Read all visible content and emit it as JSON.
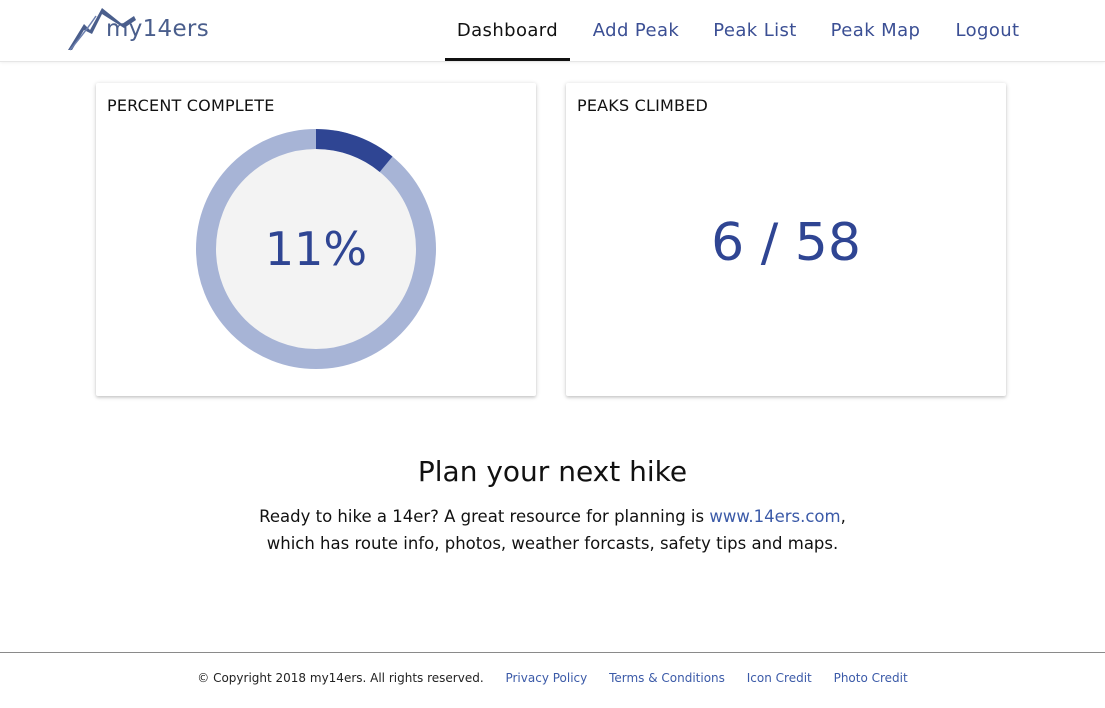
{
  "brand": {
    "logo_text": "my14ers",
    "mountain_icon": "mountain-logo-icon"
  },
  "nav": {
    "items": [
      {
        "label": "Dashboard",
        "active": true
      },
      {
        "label": "Add Peak",
        "active": false
      },
      {
        "label": "Peak List",
        "active": false
      },
      {
        "label": "Peak Map",
        "active": false
      },
      {
        "label": "Logout",
        "active": false
      }
    ]
  },
  "percent_card": {
    "title": "PERCENT COMPLETE",
    "value_label": "11%",
    "progress_fraction": 0.11
  },
  "peaks_card": {
    "title": "PEAKS CLIMBED",
    "count_label": "6 / 58"
  },
  "plan": {
    "title": "Plan your next hike",
    "text_before_link": "Ready to hike a 14er? A great resource for planning is ",
    "link_text": "www.14ers.com",
    "text_after_link": ",",
    "line2": "which has route info, photos, weather forcasts, safety tips and maps."
  },
  "footer": {
    "copyright": "© Copyright 2018 my14ers. All rights reserved.",
    "links": [
      "Privacy Policy",
      "Terms & Conditions",
      "Icon Credit",
      "Photo Credit"
    ]
  },
  "colors": {
    "accent": "#2f4593",
    "ring_track": "#a7b4d6",
    "ring_fill": "#2f4593",
    "donut_inner": "#f3f3f3",
    "link": "#3b5aa8"
  }
}
